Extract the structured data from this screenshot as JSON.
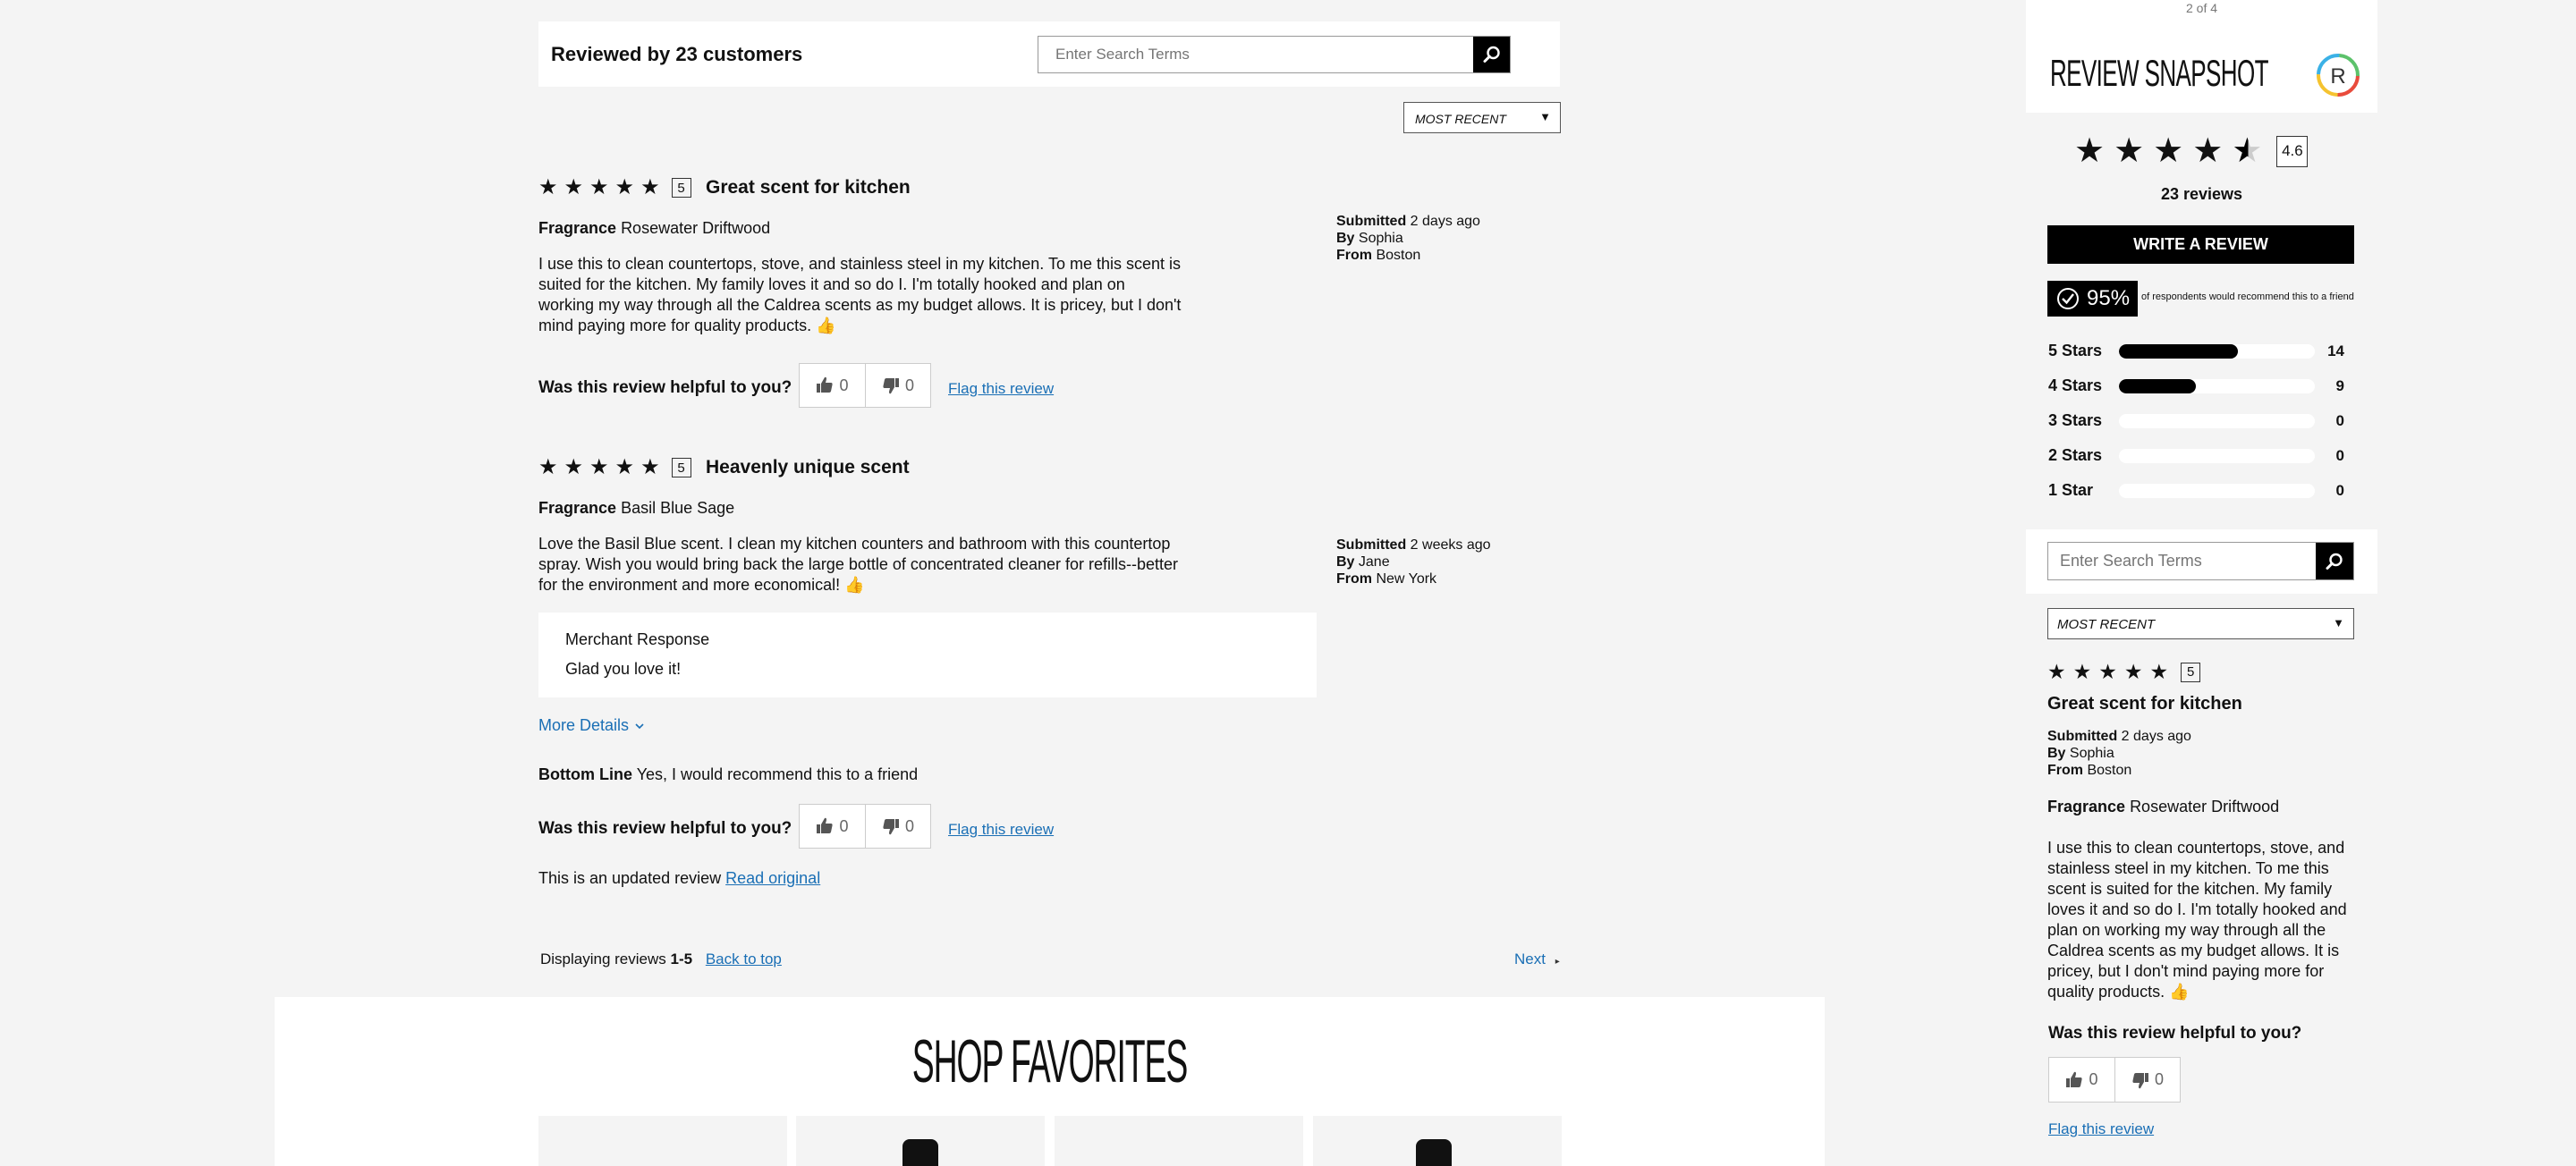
{
  "header": {
    "review_count_title": "Reviewed by 23 customers",
    "search_placeholder": "Enter Search Terms",
    "sort_label": "MOST RECENT"
  },
  "reviews": [
    {
      "rating": "5",
      "title": "Great scent for kitchen",
      "fragrance_label": "Fragrance",
      "fragrance_value": "Rosewater Driftwood",
      "body": "I use this to clean countertops, stove, and stainless steel in my kitchen. To me this scent is suited for the kitchen. My family loves it and so do I. I'm totally hooked and plan on working my way through all the Caldrea scents as my budget allows. It is pricey, but I don't mind paying more for quality products. 👍",
      "submitted_label": "Submitted",
      "submitted_value": "2 days ago",
      "by_label": "By",
      "by_value": "Sophia",
      "from_label": "From",
      "from_value": "Boston",
      "helpful_label": "Was this review helpful to you?",
      "up_count": "0",
      "down_count": "0",
      "flag_label": "Flag this review"
    },
    {
      "rating": "5",
      "title": "Heavenly unique scent",
      "fragrance_label": "Fragrance",
      "fragrance_value": "Basil Blue Sage",
      "body": "Love the Basil Blue scent. I clean my kitchen counters and bathroom with this countertop spray. Wish you would bring back the large bottle of concentrated cleaner for refills--better for the environment and more economical! 👍",
      "submitted_label": "Submitted",
      "submitted_value": "2 weeks ago",
      "by_label": "By",
      "by_value": "Jane",
      "from_label": "From",
      "from_value": "New York",
      "merchant_response_label": "Merchant Response",
      "merchant_response_text": "Glad you love it!",
      "more_details_label": "More Details",
      "bottom_line_label": "Bottom Line",
      "bottom_line_value": "Yes, I would recommend this to a friend",
      "helpful_label": "Was this review helpful to you?",
      "up_count": "0",
      "down_count": "0",
      "flag_label": "Flag this review",
      "updated_text": "This is an updated review",
      "read_original_label": "Read original"
    }
  ],
  "pagination": {
    "displaying_label": "Displaying reviews",
    "range": "1-5",
    "back_to_top": "Back to top",
    "next_label": "Next"
  },
  "sidebar": {
    "page_indicator": "2 of 4",
    "snapshot_title": "REVIEW SNAPSHOT",
    "average_rating": "4.6",
    "average_rating_value": 4.6,
    "total_reviews": "23 reviews",
    "write_review_label": "WRITE A REVIEW",
    "recommend_percent": "95%",
    "recommend_text": "of respondents would recommend this to a friend",
    "histogram": [
      {
        "label": "5 Stars",
        "count": "14",
        "fraction": 0.609
      },
      {
        "label": "4 Stars",
        "count": "9",
        "fraction": 0.391
      },
      {
        "label": "3 Stars",
        "count": "0",
        "fraction": 0
      },
      {
        "label": "2 Stars",
        "count": "0",
        "fraction": 0
      },
      {
        "label": "1 Star",
        "count": "0",
        "fraction": 0
      }
    ],
    "search_placeholder": "Enter Search Terms",
    "sort_label": "MOST RECENT",
    "review": {
      "rating": "5",
      "title": "Great scent for kitchen",
      "submitted_label": "Submitted",
      "submitted_value": "2 days ago",
      "by_label": "By",
      "by_value": "Sophia",
      "from_label": "From",
      "from_value": "Boston",
      "fragrance_label": "Fragrance",
      "fragrance_value": "Rosewater Driftwood",
      "body": "I use this to clean countertops, stove, and stainless steel in my kitchen. To me this scent is suited for the kitchen. My family loves it and so do I. I'm totally hooked and plan on working my way through all the Caldrea scents as my budget allows. It is pricey, but I don't mind paying more for quality products. 👍",
      "helpful_label": "Was this review helpful to you?",
      "up_count": "0",
      "down_count": "0",
      "flag_label": "Flag this review"
    }
  },
  "footer": {
    "shop_favorites_title": "SHOP FAVORITES"
  },
  "icons": {
    "search": "search-icon",
    "thumbs_up": "thumbs-up-icon",
    "thumbs_down": "thumbs-down-icon",
    "chevron": "chevron-down-icon",
    "check": "check-circle-icon",
    "brand": "brand-logo-icon"
  }
}
